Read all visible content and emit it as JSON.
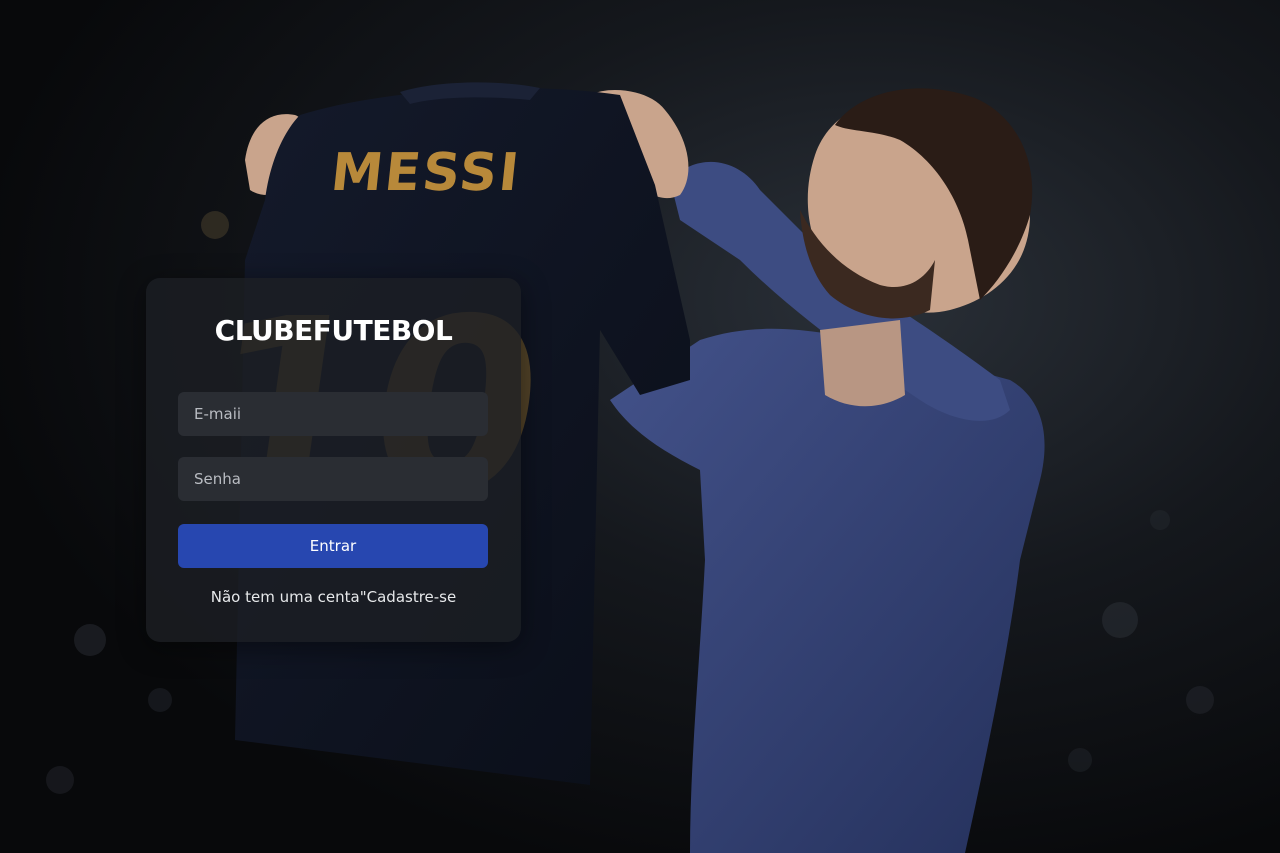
{
  "background": {
    "jersey_name": "MESSI",
    "jersey_number": "10",
    "colors": {
      "jersey": "#0f1422",
      "lettering": "#b8893a",
      "shirt": "#36457a",
      "skin": "#c9a48c",
      "hair": "#2a1c16"
    }
  },
  "login": {
    "brand": "CLUBEFUTEBOL",
    "email_placeholder": "E-maii",
    "password_placeholder": "Senha",
    "submit_label": "Entrar",
    "signup_text": "Não tem uma centa\"Cadastre-se",
    "colors": {
      "card": "#1c1f24",
      "input": "#2a2d33",
      "button": "#2747b0"
    }
  }
}
